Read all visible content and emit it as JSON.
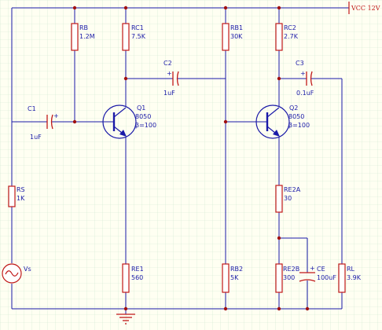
{
  "supply": {
    "label": "VCC 12V"
  },
  "source": {
    "ref": "Vs"
  },
  "resistors": [
    {
      "id": "rb",
      "ref": "RB",
      "value": "1.2M"
    },
    {
      "id": "rc1",
      "ref": "RC1",
      "value": "7.5K"
    },
    {
      "id": "rb1",
      "ref": "RB1",
      "value": "30K"
    },
    {
      "id": "rc2",
      "ref": "RC2",
      "value": "2.7K"
    },
    {
      "id": "rs",
      "ref": "RS",
      "value": "1K"
    },
    {
      "id": "re2a",
      "ref": "RE2A",
      "value": "30"
    },
    {
      "id": "re1",
      "ref": "RE1",
      "value": "560"
    },
    {
      "id": "rb2",
      "ref": "RB2",
      "value": "5K"
    },
    {
      "id": "re2b",
      "ref": "RE2B",
      "value": "300"
    },
    {
      "id": "rl",
      "ref": "RL",
      "value": "3.9K"
    }
  ],
  "capacitors": [
    {
      "id": "c1",
      "ref": "C1",
      "value": "1uF",
      "polarity": "+"
    },
    {
      "id": "c2",
      "ref": "C2",
      "value": "1uF",
      "polarity": "+"
    },
    {
      "id": "c3",
      "ref": "C3",
      "value": "0.1uF",
      "polarity": "+"
    },
    {
      "id": "ce",
      "ref": "CE",
      "value": "100uF",
      "polarity": "+"
    }
  ],
  "transistors": [
    {
      "id": "q1",
      "ref": "Q1",
      "part": "8050",
      "beta": "β=100"
    },
    {
      "id": "q2",
      "ref": "Q2",
      "part": "8050",
      "beta": "β=100"
    }
  ],
  "colors": {
    "wire": "#1a1aa8",
    "component": "#c01818",
    "dot": "#a01010",
    "grid": "#cfe8cf",
    "background": "#fffff2"
  }
}
